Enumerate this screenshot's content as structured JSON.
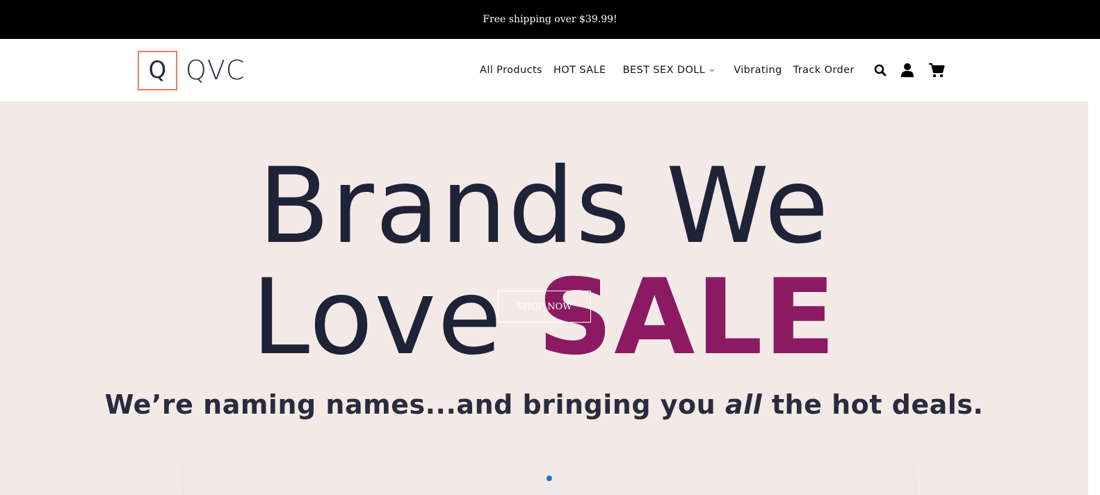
{
  "announcement": {
    "text": "Free shipping over $39.99!"
  },
  "header": {
    "logo": {
      "mark": "Q",
      "wordmark": "QVC",
      "brand_color": "#ed7b62"
    },
    "nav": [
      {
        "label": "All Products"
      },
      {
        "label": "HOT SALE"
      },
      {
        "label": "BEST SEX DOLL",
        "has_dropdown": true
      },
      {
        "label": "Vibrating"
      },
      {
        "label": "Track Order"
      }
    ],
    "icons": [
      "search-icon",
      "user-icon",
      "cart-icon"
    ]
  },
  "hero": {
    "line1": "Brands We",
    "line2_prefix": "Love ",
    "line2_highlight": "SALE",
    "subtitle_before": "We’re naming names...and bringing you ",
    "subtitle_emphasis": "all",
    "subtitle_after": " the hot deals.",
    "cta_label": "SHOP NOW",
    "colors": {
      "background": "#f3eae8",
      "headline": "#1f2338",
      "highlight": "#8b1a62"
    },
    "carousel": {
      "slide_count": 1,
      "active_index": 0,
      "indicator_color": "#1177dd"
    }
  }
}
